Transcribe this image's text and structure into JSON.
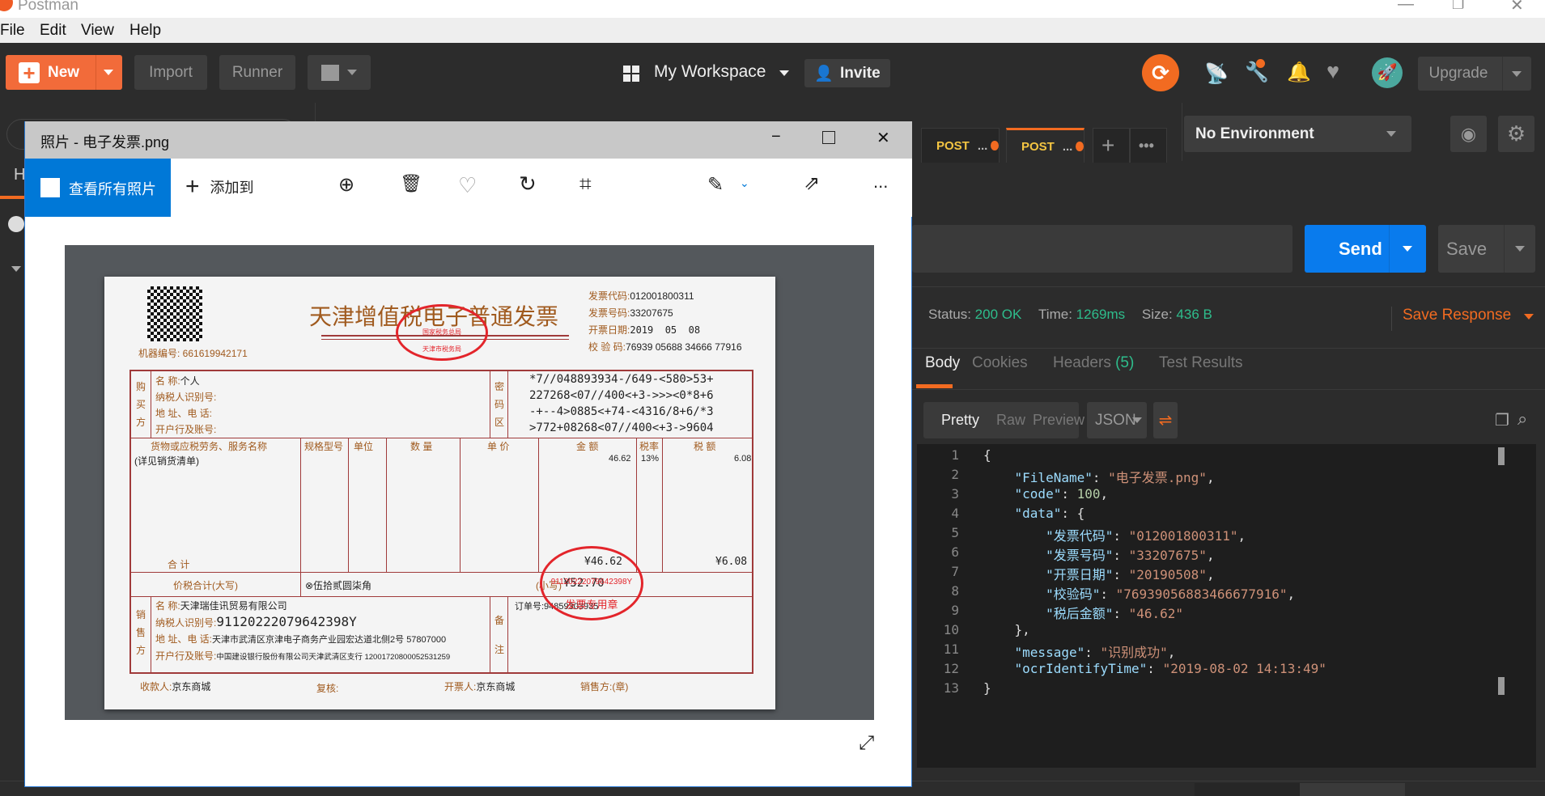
{
  "app": {
    "title": "Postman"
  },
  "menu": [
    "File",
    "Edit",
    "View",
    "Help"
  ],
  "toolbar": {
    "new": "New",
    "import": "Import",
    "runner": "Runner",
    "workspace": "My Workspace",
    "invite": "Invite",
    "upgrade": "Upgrade"
  },
  "sidebar": {
    "tab_letter": "H"
  },
  "tabs": [
    {
      "method": "POST",
      "label": "..."
    },
    {
      "method": "POST",
      "label": "..."
    }
  ],
  "environment": {
    "selected": "No Environment"
  },
  "request": {
    "send": "Send",
    "save": "Save"
  },
  "response": {
    "status_label": "Status:",
    "status": "200 OK",
    "time_label": "Time:",
    "time": "1269ms",
    "size_label": "Size:",
    "size": "436 B",
    "save_response": "Save Response",
    "tabs": [
      "Body",
      "Cookies",
      "Headers",
      "Test Results"
    ],
    "headers_count": "(5)",
    "views": [
      "Pretty",
      "Raw",
      "Preview"
    ],
    "format": "JSON",
    "lines": [
      [
        {
          "t": "{",
          "c": "p"
        }
      ],
      [
        {
          "t": "    \"FileName\"",
          "c": "k"
        },
        {
          "t": ": ",
          "c": "p"
        },
        {
          "t": "\"电子发票.png\"",
          "c": "s"
        },
        {
          "t": ",",
          "c": "p"
        }
      ],
      [
        {
          "t": "    \"code\"",
          "c": "k"
        },
        {
          "t": ": ",
          "c": "p"
        },
        {
          "t": "100",
          "c": "n"
        },
        {
          "t": ",",
          "c": "p"
        }
      ],
      [
        {
          "t": "    \"data\"",
          "c": "k"
        },
        {
          "t": ": {",
          "c": "p"
        }
      ],
      [
        {
          "t": "        \"发票代码\"",
          "c": "k"
        },
        {
          "t": ": ",
          "c": "p"
        },
        {
          "t": "\"012001800311\"",
          "c": "s"
        },
        {
          "t": ",",
          "c": "p"
        }
      ],
      [
        {
          "t": "        \"发票号码\"",
          "c": "k"
        },
        {
          "t": ": ",
          "c": "p"
        },
        {
          "t": "\"33207675\"",
          "c": "s"
        },
        {
          "t": ",",
          "c": "p"
        }
      ],
      [
        {
          "t": "        \"开票日期\"",
          "c": "k"
        },
        {
          "t": ": ",
          "c": "p"
        },
        {
          "t": "\"20190508\"",
          "c": "s"
        },
        {
          "t": ",",
          "c": "p"
        }
      ],
      [
        {
          "t": "        \"校验码\"",
          "c": "k"
        },
        {
          "t": ": ",
          "c": "p"
        },
        {
          "t": "\"76939056883466677916\"",
          "c": "s"
        },
        {
          "t": ",",
          "c": "p"
        }
      ],
      [
        {
          "t": "        \"税后金额\"",
          "c": "k"
        },
        {
          "t": ": ",
          "c": "p"
        },
        {
          "t": "\"46.62\"",
          "c": "s"
        }
      ],
      [
        {
          "t": "    },",
          "c": "p"
        }
      ],
      [
        {
          "t": "    \"message\"",
          "c": "k"
        },
        {
          "t": ": ",
          "c": "p"
        },
        {
          "t": "\"识别成功\"",
          "c": "s"
        },
        {
          "t": ",",
          "c": "p"
        }
      ],
      [
        {
          "t": "    \"ocrIdentifyTime\"",
          "c": "k"
        },
        {
          "t": ": ",
          "c": "p"
        },
        {
          "t": "\"2019-08-02 14:13:49\"",
          "c": "s"
        }
      ],
      [
        {
          "t": "}",
          "c": "p"
        }
      ]
    ]
  },
  "photos": {
    "title": "照片 - 电子发票.png",
    "view_all": "查看所有照片",
    "add_to": "添加到",
    "more": "..."
  },
  "invoice": {
    "title": "天津增值税电子普通发票",
    "machine_no": "机器编号: 661619942171",
    "code_label": "发票代码:",
    "code": "012001800311",
    "number_label": "发票号码:",
    "number": "33207675",
    "date_label": "开票日期:",
    "date": "2019  05  08",
    "check_label": "校 验 码:",
    "check": "76939 05688 34666 77916",
    "buyer_side": "购买方",
    "buyer_name_label": "名        称:",
    "buyer_name": "个人",
    "buyer_tax_label": "纳税人识别号:",
    "buyer_addr_label": "地 址、电 话:",
    "buyer_bank_label": "开户行及账号:",
    "cipher_side": "密码区",
    "cipher": [
      "*7//048893934-/649-<580>53+",
      "227268<07//400<+3->>><0*8+6",
      "-+--4>0885<+74-<4316/8+6/*3",
      ">772+08268<07//400<+3->9604"
    ],
    "cols": [
      "货物或应税劳务、服务名称",
      "规格型号",
      "单位",
      "数 量",
      "单 价",
      "金  额",
      "税率",
      "税  额"
    ],
    "item_name": "(详见销货清单)",
    "item_amount": "46.62",
    "item_rate": "13%",
    "item_tax": "6.08",
    "total_label": "合          计",
    "total_amount": "¥46.62",
    "total_tax": "¥6.08",
    "grand_label": "价税合计(大写)",
    "grand_words": "⊗伍拾贰圆柒角",
    "grand_small_label": "(小写)",
    "grand_small": "¥52.70",
    "seller_side": "销售方",
    "seller_name_label": "名        称:",
    "seller_name": "天津瑞佳讯贸易有限公司",
    "seller_tax_label": "纳税人识别号:",
    "seller_tax": "91120222079642398Y",
    "seller_addr_label": "地 址、电 话:",
    "seller_addr": "天津市武清区京津电子商务产业园宏达道北侧2号 57807000",
    "seller_bank_label": "开户行及账号:",
    "seller_bank": "中国建设银行股份有限公司天津武清区支行 12001720800052531259",
    "remark_side": "备注",
    "order": "订单号:94859303935",
    "payee_label": "收款人:",
    "payee": "京东商城",
    "reviewer_label": "复核:",
    "drawer_label": "开票人:",
    "drawer": "京东商城",
    "seller_seal_label": "销售方:(章)",
    "seal_top": "国家税务总局",
    "seal_bottom": "天津市税务局",
    "seal2_id": "91120222079642398Y",
    "seal2_text": "发票专用章"
  }
}
